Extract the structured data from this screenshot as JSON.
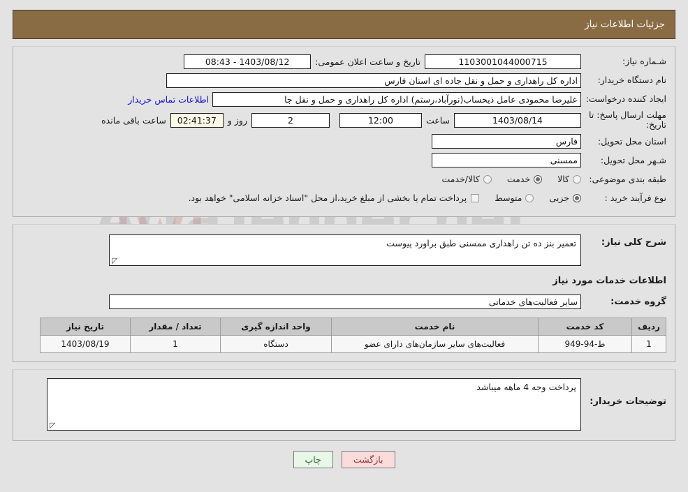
{
  "header": {
    "title": "جزئیات اطلاعات نیاز"
  },
  "info": {
    "need_number_label": "شـماره نیاز:",
    "need_number_value": "1103001044000715",
    "announce_label": "تاریخ و ساعت اعلان عمومی:",
    "announce_value": "1403/08/12 - 08:43",
    "buyer_org_label": "نام دستگاه خریدار:",
    "buyer_org_value": "اداره کل راهداری و حمل و نقل جاده ای استان فارس",
    "creator_label": "ایجاد کننده درخواست:",
    "creator_value": "علیرضا محمودی عامل ذیحساب(نورآباد،رستم) اداره کل راهداری و حمل و نقل جا",
    "contact_link": "اطلاعات تماس خریدار",
    "deadline_label": "مهلت ارسال پاسخ: تا تاریخ:",
    "deadline_date": "1403/08/14",
    "hour_word": "ساعت",
    "deadline_time": "12:00",
    "days_value": "2",
    "days_word": "روز و",
    "timer_value": "02:41:37",
    "remaining_word": "ساعت باقی مانده",
    "province_label": "استان محل تحویل:",
    "province_value": "فارس",
    "city_label": "شـهر محل تحویل:",
    "city_value": "ممسنی",
    "category_label": "طبقه بندی موضوعی:",
    "category_options": [
      {
        "label": "کالا",
        "selected": false
      },
      {
        "label": "خدمت",
        "selected": true
      },
      {
        "label": "کالا/خدمت",
        "selected": false
      }
    ],
    "process_label": "نوع فرآیند خرید :",
    "process_options": [
      {
        "label": "جزیی",
        "selected": true
      },
      {
        "label": "متوسط",
        "selected": false
      }
    ],
    "treasury_checked": false,
    "treasury_text": "پرداخت تمام یا بخشی از مبلغ خرید،از محل \"اسناد خزانه اسلامی\" خواهد بود."
  },
  "description": {
    "label": "شرح کلی نیاز:",
    "value": "تعمیر بنز ده تن راهداری ممسنی طبق براورد پیوست"
  },
  "services": {
    "section_title": "اطلاعات خدمات مورد نیاز",
    "group_label": "گروه خدمت:",
    "group_value": "سایر فعالیت‌های خدماتی",
    "columns": [
      "ردیف",
      "کد خدمت",
      "نام خدمت",
      "واحد اندازه گیری",
      "تعداد / مقدار",
      "تاریخ نیاز"
    ],
    "rows": [
      {
        "row_no": "1",
        "code": "ط-94-949",
        "name": "فعالیت‌های سایر سازمان‌های دارای عضو",
        "unit": "دستگاه",
        "qty": "1",
        "need_date": "1403/08/19"
      }
    ]
  },
  "notes": {
    "label": "توضیحات خریدار:",
    "value": "پرداخت وجه 4 ماهه میباشد"
  },
  "footer": {
    "back_label": "بازگشت",
    "print_label": "چاپ"
  },
  "watermark": {
    "text": "ArtaTender.net"
  },
  "colors": {
    "header_bg": "#8a6c44",
    "link": "#1111cc",
    "timer_bg": "#fbfbe8",
    "back_btn_bg": "#fadcdc",
    "print_btn_bg": "#e9f7e9",
    "table_header_bg": "#c9c9c9"
  }
}
